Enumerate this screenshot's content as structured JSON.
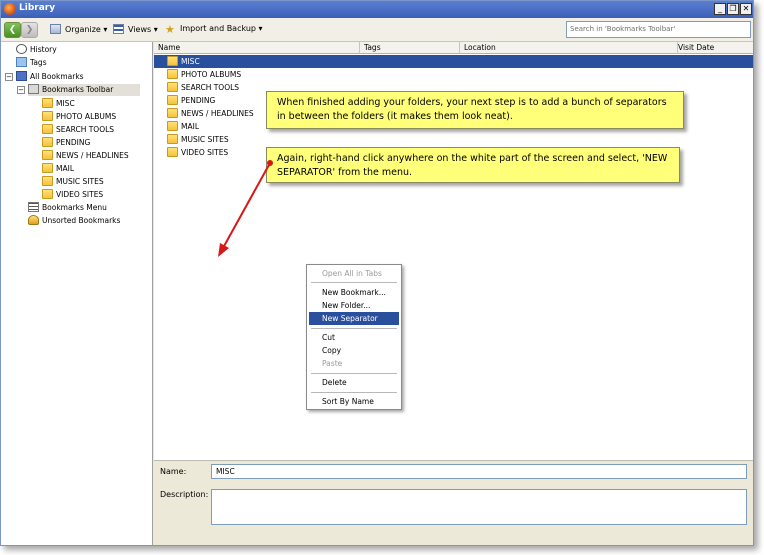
{
  "window": {
    "title": "Library",
    "controls": [
      "_",
      "❐",
      "✕"
    ]
  },
  "toolbar": {
    "back": "❮",
    "forward": "❯",
    "organize": "Organize ▾",
    "views": "Views ▾",
    "import_backup": "Import and Backup ▾",
    "search_placeholder": "Search in 'Bookmarks Toolbar'"
  },
  "sidebar": {
    "history": "History",
    "tags": "Tags",
    "all_bookmarks": "All Bookmarks",
    "bookmarks_toolbar": "Bookmarks Toolbar",
    "toolbar_folders": [
      "MISC",
      "PHOTO ALBUMS",
      "SEARCH TOOLS",
      "PENDING",
      "NEWS / HEADLINES",
      "MAIL",
      "MUSIC SITES",
      "VIDEO SITES"
    ],
    "bookmarks_menu": "Bookmarks Menu",
    "unsorted": "Unsorted Bookmarks"
  },
  "columns": [
    "Name",
    "Tags",
    "Location",
    "Visit Date"
  ],
  "list": [
    "MISC",
    "PHOTO ALBUMS",
    "SEARCH TOOLS",
    "PENDING",
    "NEWS / HEADLINES",
    "MAIL",
    "MUSIC SITES",
    "VIDEO SITES"
  ],
  "callouts": {
    "first": "When finished adding your folders, your next step is to add a bunch of separators in between the folders (it makes them look neat).",
    "second": "Again, right-hand click anywhere on the white part of the screen and select, 'NEW SEPARATOR' from the menu."
  },
  "context_menu": {
    "open_all": "Open All in Tabs",
    "new_bookmark": "New Bookmark...",
    "new_folder": "New Folder...",
    "new_separator": "New Separator",
    "cut": "Cut",
    "copy": "Copy",
    "paste": "Paste",
    "delete": "Delete",
    "sort": "Sort By Name"
  },
  "details": {
    "name_label": "Name:",
    "name_value": "MISC",
    "description_label": "Description:"
  },
  "colors": {
    "selection": "#2a4f9c",
    "callout": "#ffff7a",
    "arrow": "#d61818"
  }
}
